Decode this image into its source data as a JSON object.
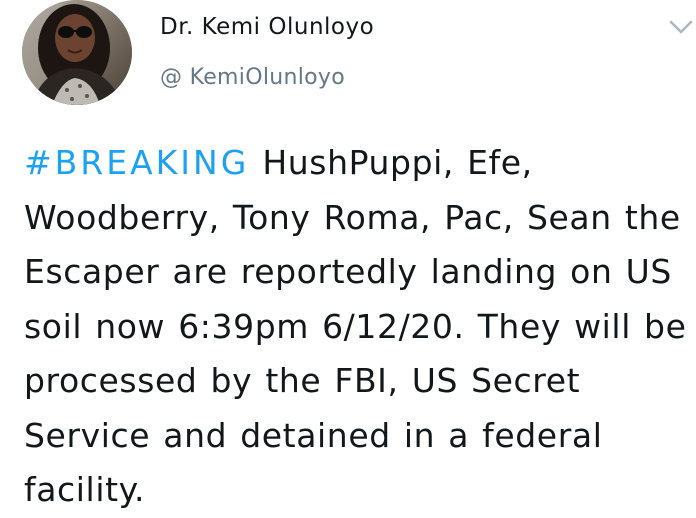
{
  "tweet": {
    "author": {
      "display_name": "Dr. Kemi Olunloyo",
      "handle": "@ KemiOlunloyo",
      "avatar_icon": "profile-photo"
    },
    "menu_icon": "chevron-down-icon",
    "hashtag": "#BREAKING",
    "body": " HushPuppi, Efe, Woodberry, Tony Roma, Pac, Sean the Escaper are reportedly landing on US soil now 6:39pm 6/12/20. They will be processed by the FBI, US Secret Service and detained in a federal facility.",
    "colors": {
      "hashtag": "#1da1f2",
      "handle": "#657786",
      "text": "#14171a"
    }
  }
}
